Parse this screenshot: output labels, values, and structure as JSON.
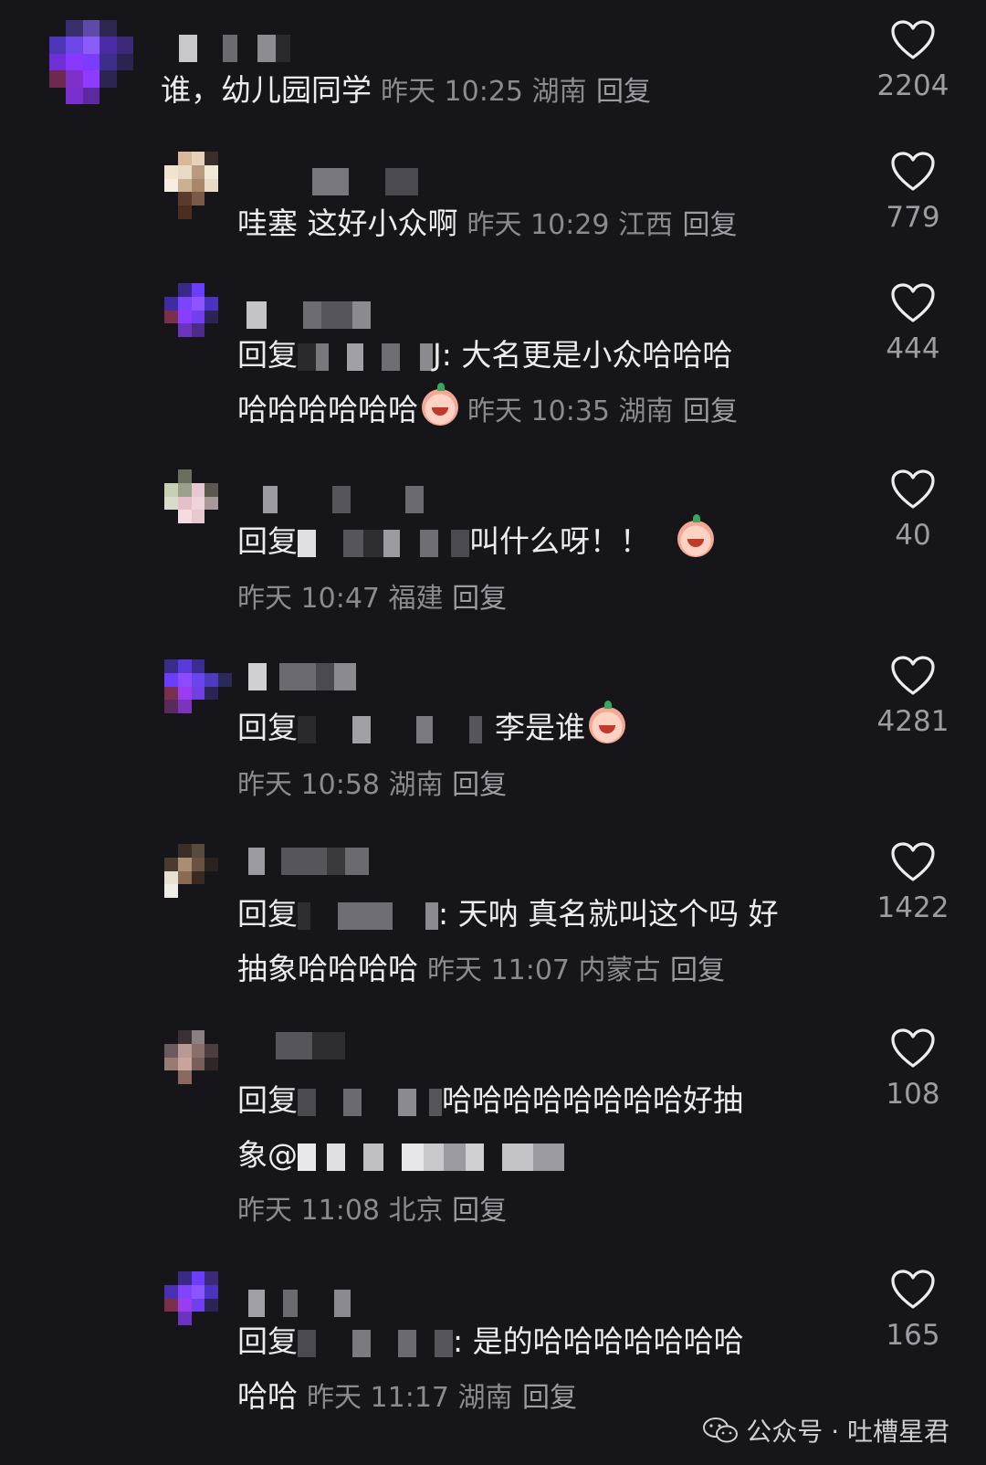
{
  "comments": [
    {
      "text": "谁，幼儿园同学",
      "time": "昨天 10:25 湖南",
      "reply_label": "回复",
      "likes": "2204"
    },
    {
      "text": "哇塞 这好小众啊",
      "time": "昨天 10:29 江西",
      "reply_label": "回复",
      "likes": "779"
    },
    {
      "prefix": "回复",
      "suffix": "J: 大名更是小众哈哈哈",
      "line2": "哈哈哈哈哈哈",
      "time": "昨天 10:35 湖南",
      "reply_label": "回复",
      "likes": "444"
    },
    {
      "prefix": "回复",
      "suffix": "叫什么呀！！",
      "time": "昨天 10:47 福建",
      "reply_label": "回复",
      "likes": "40"
    },
    {
      "prefix": "回复",
      "suffix": "李是谁",
      "time": "昨天 10:58 湖南",
      "reply_label": "回复",
      "likes": "4281"
    },
    {
      "prefix": "回复",
      "suffix": ": 天呐 真名就叫这个吗 好",
      "line2": "抽象哈哈哈哈",
      "time": "昨天 11:07 内蒙古",
      "reply_label": "回复",
      "likes": "1422"
    },
    {
      "prefix": "回复",
      "suffix": "哈哈哈哈哈哈哈哈好抽",
      "line2": "象@",
      "time": "昨天 11:08 北京",
      "reply_label": "回复",
      "likes": "108"
    },
    {
      "prefix": "回复",
      "suffix": ": 是的哈哈哈哈哈哈哈",
      "line2": "哈哈",
      "time": "昨天 11:17 湖南",
      "reply_label": "回复",
      "likes": "165"
    }
  ],
  "watermark": {
    "label": "公众号 · 吐槽星君"
  },
  "colors": {
    "background": "#161519",
    "text": "#ececee",
    "meta": "#8a8a90",
    "avatar_purple": "#7a3cff"
  }
}
